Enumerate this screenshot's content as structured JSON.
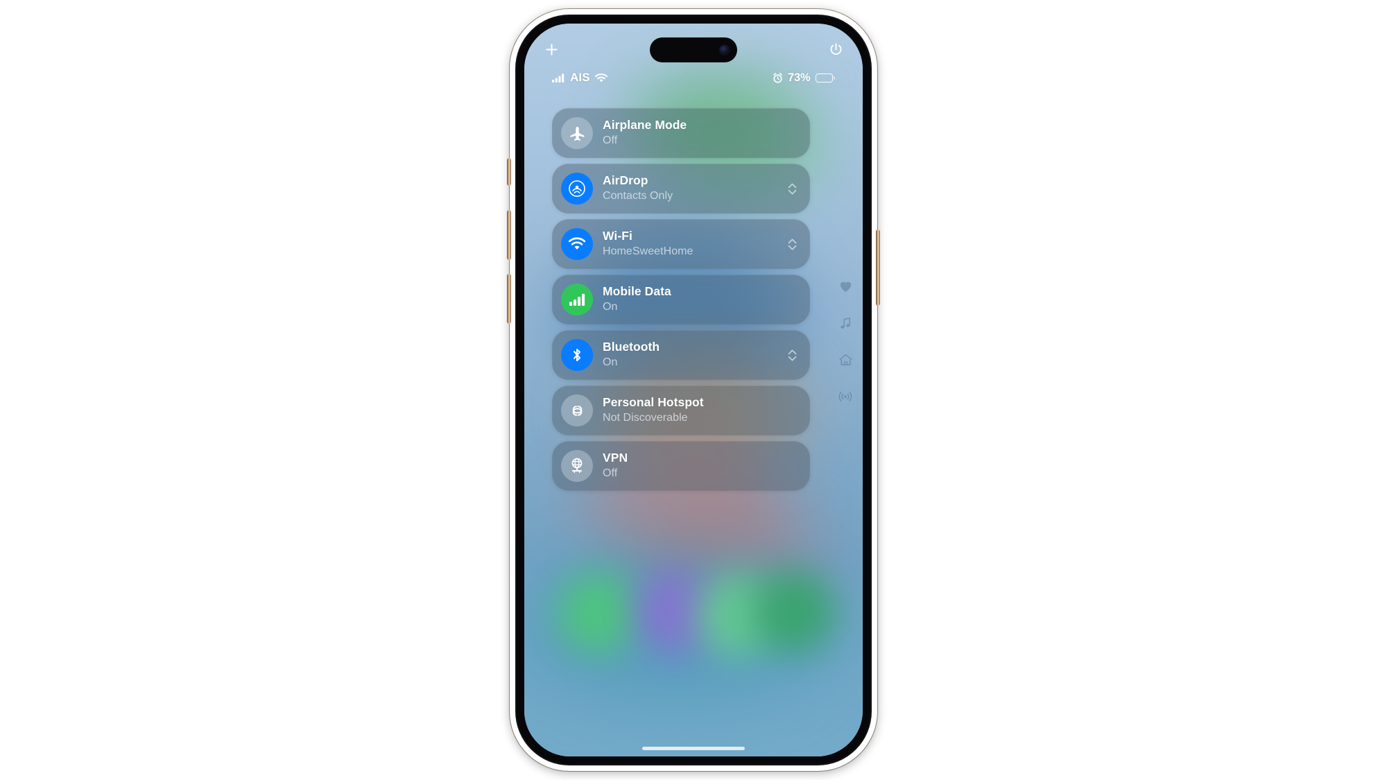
{
  "device": {
    "name": "iPhone",
    "frame_color": "#b98e66"
  },
  "status_bar": {
    "signal_icon": "cellular-signal-icon",
    "carrier": "AIS",
    "wifi_icon": "wifi-icon",
    "alarm_icon": "alarm-clock-icon",
    "battery_percentage": "73%",
    "battery_level": 73,
    "battery_icon": "battery-icon"
  },
  "top_controls": {
    "add_label": "+",
    "add_icon": "plus-icon",
    "power_icon": "power-icon"
  },
  "connectivity": {
    "tiles": [
      {
        "name": "airplane-mode",
        "title": "Airplane Mode",
        "status": "Off",
        "icon": "airplane-icon",
        "icon_style": "off",
        "has_chevron": false
      },
      {
        "name": "airdrop",
        "title": "AirDrop",
        "status": "Contacts Only",
        "icon": "airdrop-icon",
        "icon_style": "blue",
        "has_chevron": true
      },
      {
        "name": "wifi",
        "title": "Wi-Fi",
        "status": "HomeSweetHome",
        "icon": "wifi-icon",
        "icon_style": "blue",
        "has_chevron": true
      },
      {
        "name": "mobile-data",
        "title": "Mobile Data",
        "status": "On",
        "icon": "cellular-bars-icon",
        "icon_style": "green",
        "has_chevron": false
      },
      {
        "name": "bluetooth",
        "title": "Bluetooth",
        "status": "On",
        "icon": "bluetooth-icon",
        "icon_style": "blue",
        "has_chevron": true
      },
      {
        "name": "personal-hotspot",
        "title": "Personal Hotspot",
        "status": "Not Discoverable",
        "icon": "hotspot-links-icon",
        "icon_style": "off",
        "has_chevron": false
      },
      {
        "name": "vpn",
        "title": "VPN",
        "status": "Off",
        "icon": "vpn-globe-icon",
        "icon_style": "off",
        "has_chevron": false
      }
    ]
  },
  "side_rail": {
    "items": [
      {
        "name": "favourites",
        "icon": "heart-icon"
      },
      {
        "name": "music",
        "icon": "music-note-icon"
      },
      {
        "name": "home",
        "icon": "home-icon"
      },
      {
        "name": "connectivity",
        "icon": "broadcast-icon"
      }
    ]
  },
  "colors": {
    "accent_blue": "#0a7cff",
    "accent_green": "#31c65a",
    "tile_background": "rgba(86,95,105,.46)",
    "icon_off_background": "rgba(218,226,235,.36)",
    "text_primary": "#ffffff",
    "text_secondary": "rgba(233,238,244,.74)"
  }
}
